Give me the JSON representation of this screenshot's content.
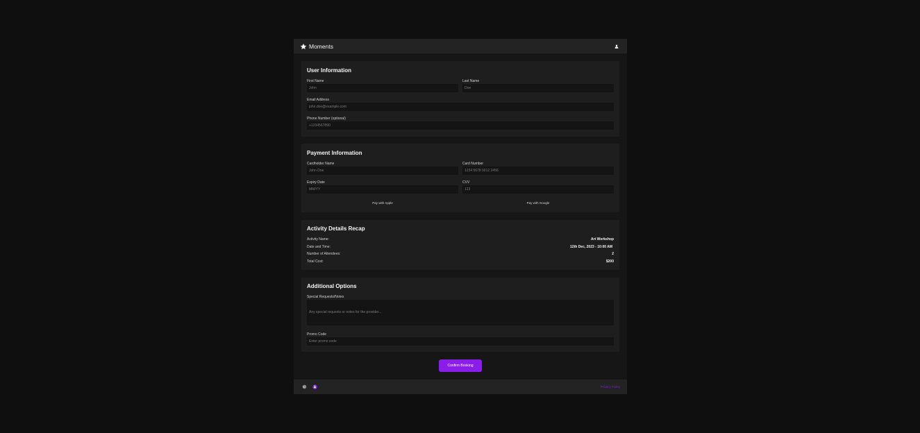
{
  "header": {
    "title": "Moments",
    "icon": "star-icon",
    "user_icon": "user-icon"
  },
  "user_info": {
    "title": "User Information",
    "first_name_label": "First Name",
    "first_name_placeholder": "John",
    "last_name_label": "Last Name",
    "last_name_placeholder": "Doe",
    "email_label": "Email Address",
    "email_placeholder": "john.doe@example.com",
    "phone_label": "Phone Number (optional)",
    "phone_placeholder": "+1234567890"
  },
  "payment": {
    "title": "Payment Information",
    "cardholder_label": "Cardholder Name",
    "cardholder_placeholder": "John Doe",
    "card_number_label": "Card Number",
    "card_number_placeholder": "1234 5678 9012 3456",
    "expiry_label": "Expiry Date",
    "expiry_placeholder": "MM/YY",
    "cvv_label": "CVV",
    "cvv_placeholder": "123",
    "apple_pay_label": "Pay with Apple",
    "google_pay_label": "Pay with Google"
  },
  "recap": {
    "title": "Activity Details Recap",
    "rows": [
      {
        "label": "Activity Name:",
        "value": "Art Workshop"
      },
      {
        "label": "Date and Time:",
        "value": "12th Dec, 2023 - 10:00 AM"
      },
      {
        "label": "Number of Attendees:",
        "value": "2"
      },
      {
        "label": "Total Cost:",
        "value": "$200"
      }
    ]
  },
  "options": {
    "title": "Additional Options",
    "notes_label": "Special Requests/Notes",
    "notes_placeholder": "Any special requests or notes for the provider...",
    "promo_label": "Promo Code",
    "promo_placeholder": "Enter promo code"
  },
  "confirm_label": "Confirm Booking",
  "footer": {
    "icons": [
      "globe-icon",
      "profile-icon"
    ],
    "privacy_label": "Privacy Policy"
  },
  "colors": {
    "accent": "#8a1ee8",
    "background": "#0f0f0f",
    "card": "#1e1e1e",
    "bar": "#232323",
    "input": "#141414"
  }
}
